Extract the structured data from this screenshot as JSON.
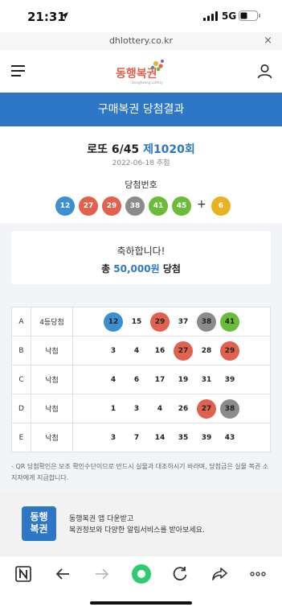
{
  "status_bar": {
    "time": "21:31",
    "network": "5G"
  },
  "browser": {
    "url": "dhlottery.co.kr",
    "close_label": "×"
  },
  "header": {
    "logo_text": "동행복권",
    "logo_subtext": "Donghaeng Lottery"
  },
  "page_title": "구매복권 당첨결과",
  "game": {
    "name": "로또 6/45",
    "round": "제1020회",
    "draw_date": "2022-06-18 추첨",
    "winning_label": "당첨번호",
    "winning_numbers": [
      {
        "n": "12",
        "color": "blue"
      },
      {
        "n": "27",
        "color": "red"
      },
      {
        "n": "29",
        "color": "red"
      },
      {
        "n": "38",
        "color": "gray"
      },
      {
        "n": "41",
        "color": "green"
      },
      {
        "n": "45",
        "color": "green"
      }
    ],
    "plus": "+",
    "bonus_number": {
      "n": "6",
      "color": "yellow"
    }
  },
  "congrats": {
    "message": "축하합니다!",
    "prefix": "총",
    "amount": "50,000원",
    "suffix": "당첨"
  },
  "results": [
    {
      "label": "A",
      "status": "4등당첨",
      "numbers": [
        {
          "n": "12",
          "hit": "blue"
        },
        {
          "n": "15",
          "hit": ""
        },
        {
          "n": "29",
          "hit": "red"
        },
        {
          "n": "37",
          "hit": ""
        },
        {
          "n": "38",
          "hit": "gray"
        },
        {
          "n": "41",
          "hit": "green"
        }
      ]
    },
    {
      "label": "B",
      "status": "낙첨",
      "numbers": [
        {
          "n": "3",
          "hit": ""
        },
        {
          "n": "4",
          "hit": ""
        },
        {
          "n": "16",
          "hit": ""
        },
        {
          "n": "27",
          "hit": "red"
        },
        {
          "n": "28",
          "hit": ""
        },
        {
          "n": "29",
          "hit": "red"
        }
      ]
    },
    {
      "label": "C",
      "status": "낙첨",
      "numbers": [
        {
          "n": "4",
          "hit": ""
        },
        {
          "n": "6",
          "hit": ""
        },
        {
          "n": "17",
          "hit": ""
        },
        {
          "n": "19",
          "hit": ""
        },
        {
          "n": "31",
          "hit": ""
        },
        {
          "n": "39",
          "hit": ""
        }
      ]
    },
    {
      "label": "D",
      "status": "낙첨",
      "numbers": [
        {
          "n": "1",
          "hit": ""
        },
        {
          "n": "3",
          "hit": ""
        },
        {
          "n": "4",
          "hit": ""
        },
        {
          "n": "26",
          "hit": ""
        },
        {
          "n": "27",
          "hit": "red"
        },
        {
          "n": "38",
          "hit": "gray"
        }
      ]
    },
    {
      "label": "E",
      "status": "낙첨",
      "numbers": [
        {
          "n": "3",
          "hit": ""
        },
        {
          "n": "7",
          "hit": ""
        },
        {
          "n": "14",
          "hit": ""
        },
        {
          "n": "35",
          "hit": ""
        },
        {
          "n": "39",
          "hit": ""
        },
        {
          "n": "43",
          "hit": ""
        }
      ]
    }
  ],
  "note": "- QR 당첨확인은 보조 확인수단이므로 반드시 실물과 대조하시기 바라며, 당첨금은 실물 복권 소지자에게 지급합니다.",
  "app_banner": {
    "icon_text_line1": "동행",
    "icon_text_line2": "복권",
    "line1": "동행복권 앱 다운받고",
    "line2": "복권정보와 다양한 알림서비스를 받아보세요."
  },
  "colors": {
    "accent": "#2d77c6",
    "ball_blue": "#3d8fd1",
    "ball_red": "#e0624e",
    "ball_gray": "#8b8b8b",
    "ball_green": "#6cbc3c",
    "ball_yellow": "#e9b221"
  },
  "icons": [
    "location-arrow-icon",
    "signal-icon",
    "battery-icon",
    "close-icon",
    "hamburger-menu-icon",
    "user-icon",
    "naver-icon",
    "back-arrow-icon",
    "forward-arrow-icon",
    "home-green-icon",
    "reload-icon",
    "share-icon",
    "more-icon"
  ]
}
